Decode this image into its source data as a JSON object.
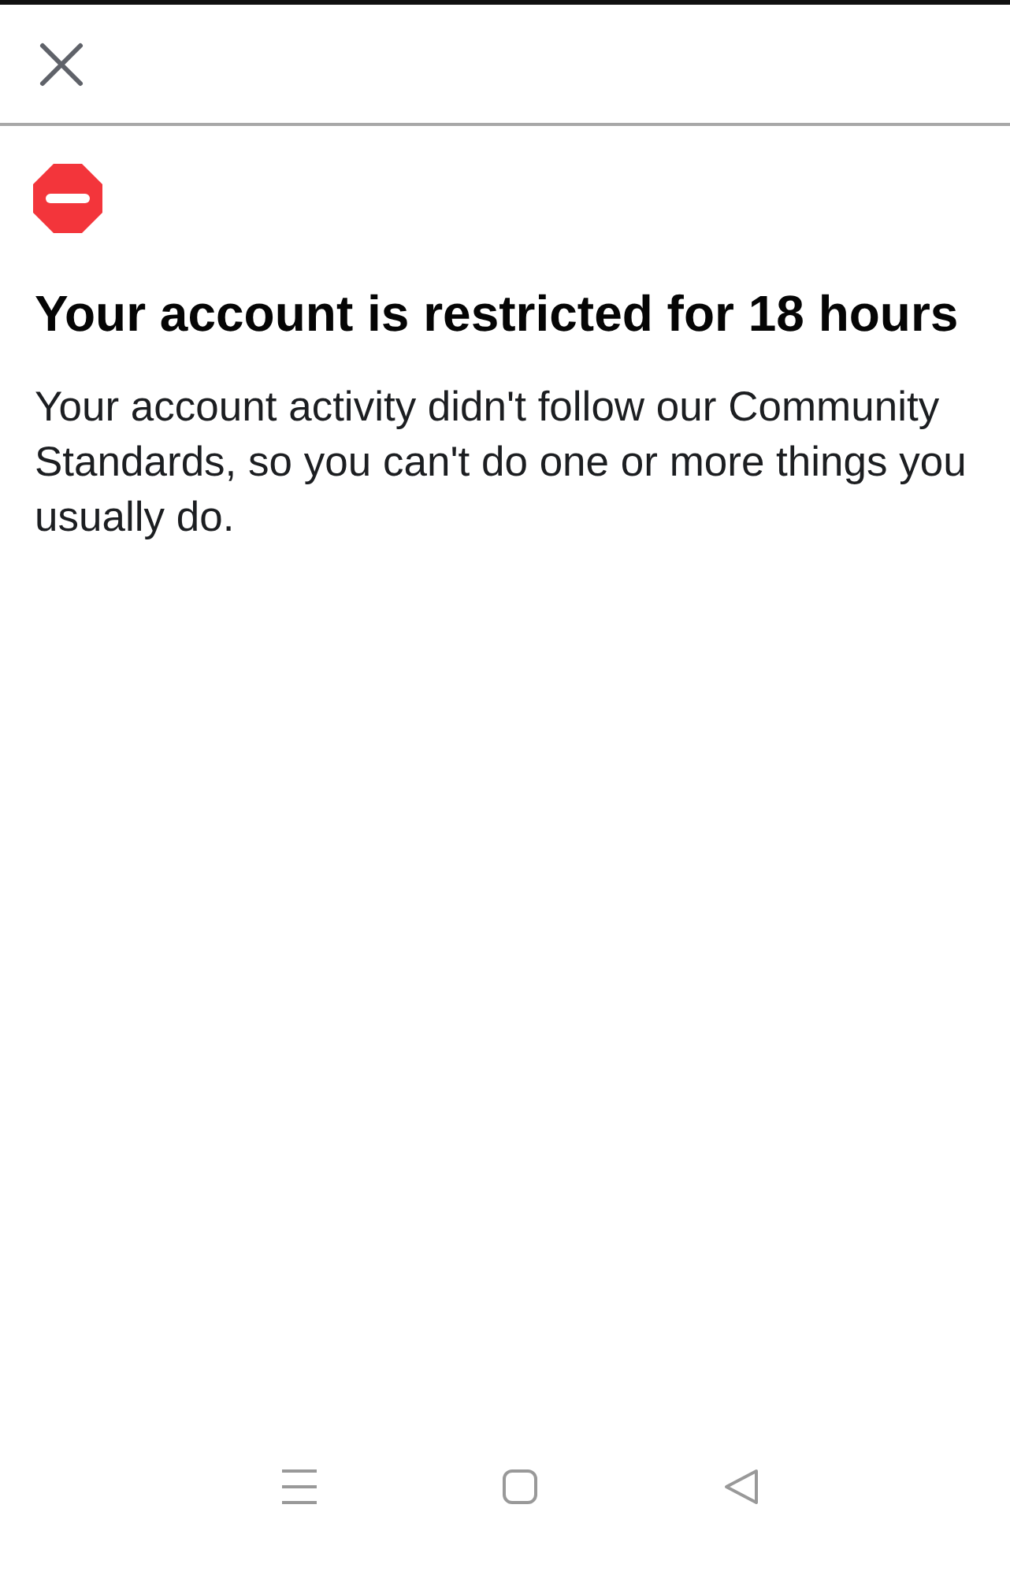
{
  "notice": {
    "title": "Your account is restricted for 18 hours",
    "message": "Your account activity didn't follow our Community Standards, so you can't do one or more things you usually do."
  }
}
